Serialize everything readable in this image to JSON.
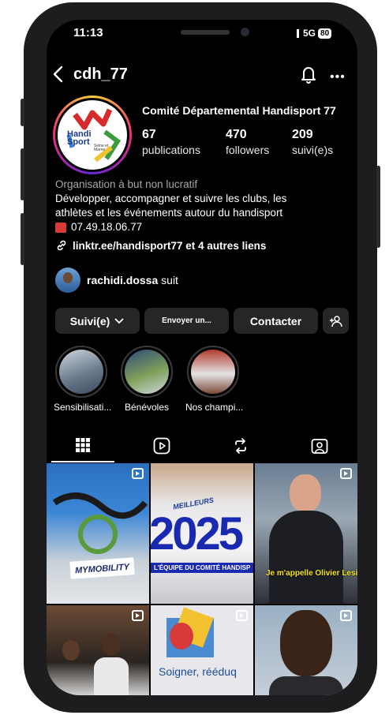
{
  "status_bar": {
    "time": "11:13",
    "network": "5G",
    "battery": "80"
  },
  "header": {
    "username": "cdh_77"
  },
  "profile": {
    "display_name": "Comité Départemental Handisport 77",
    "logo_text": "Handi Sport",
    "logo_sub": "Seine et Marne",
    "stats": [
      {
        "value": "67",
        "label": "publications"
      },
      {
        "value": "470",
        "label": "followers"
      },
      {
        "value": "209",
        "label": "suivi(e)s"
      }
    ],
    "category": "Organisation à but non lucratif",
    "bio_line1": "Développer, accompagner et suivre les clubs, les",
    "bio_line2": "athlètes et les événements autour du handisport",
    "phone": "07.49.18.06.77",
    "link": "linktr.ee/handisport77 et 4 autres liens",
    "followed_by_user": "rachidi.dossa",
    "followed_by_suffix": "suit"
  },
  "buttons": {
    "following": "Suivi(e)",
    "message": "Envoyer un...",
    "contact": "Contacter"
  },
  "highlights": [
    {
      "label": "Sensibilisati..."
    },
    {
      "label": "Bénévoles"
    },
    {
      "label": "Nos champi..."
    }
  ],
  "tabs": [
    "grid-icon",
    "reels-icon",
    "reposts-icon",
    "tagged-icon"
  ],
  "grid": {
    "post1_caption": "MYMOBILITY",
    "post2_top": "MEILLEURS",
    "post2_year": "2025",
    "post2_caption": "L'ÉQUIPE DU COMITÉ HANDISP",
    "post3_caption": "Je m'appelle Olivier Lesire",
    "post5_caption": "Soigner, rééduq"
  },
  "colors": {
    "background": "#000000",
    "button": "#262626",
    "secondary_text": "#a8a8a8"
  }
}
